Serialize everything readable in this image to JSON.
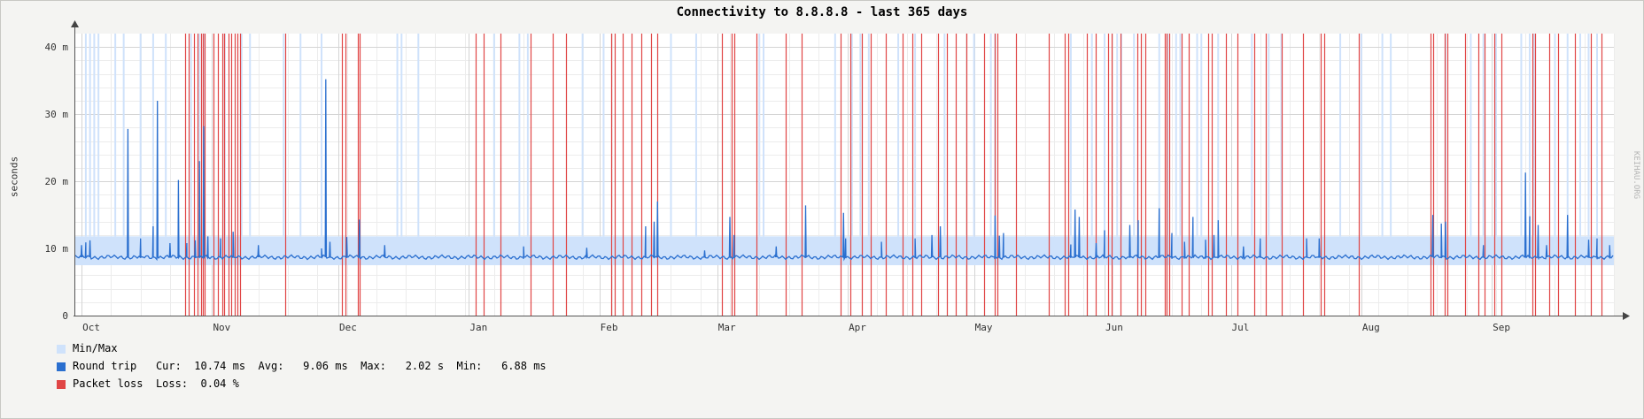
{
  "chart_data": {
    "type": "line",
    "title": "Connectivity to 8.8.8.8 - last 365 days",
    "ylabel": "seconds",
    "y_tick_labels": [
      "0",
      "10 m",
      "20 m",
      "30 m",
      "40 m"
    ],
    "y_ticks": [
      0,
      10,
      20,
      30,
      40
    ],
    "y_unit": "ms",
    "ylim": [
      0,
      42
    ],
    "x_tick_labels": [
      "Oct",
      "Nov",
      "Dec",
      "Jan",
      "Feb",
      "Mar",
      "Apr",
      "May",
      "Jun",
      "Jul",
      "Aug",
      "Sep"
    ],
    "x_tick_days": [
      0,
      31,
      61,
      92,
      123,
      151,
      182,
      212,
      243,
      273,
      304,
      335
    ],
    "xlim_days": [
      -1.5,
      364
    ],
    "grid": true,
    "legend_position": "bottom-left",
    "series": [
      {
        "name": "Min/Max",
        "kind": "band",
        "color": "#cfe2fb",
        "band_low_ms": 7.5,
        "band_high_ms": 11.8,
        "spike_days": [
          1,
          2,
          3,
          4,
          8,
          10,
          14,
          17,
          20,
          26,
          28,
          29,
          34,
          38,
          40,
          48,
          52,
          57,
          75,
          76,
          80,
          98,
          104,
          106,
          119,
          124,
          140,
          146,
          161,
          162,
          179,
          183,
          185,
          187,
          194,
          198,
          205,
          212,
          216,
          217,
          235,
          240,
          243,
          246,
          247,
          250,
          256,
          258,
          260,
          261,
          265,
          266,
          270,
          278,
          282,
          285,
          299,
          304,
          309,
          311,
          324,
          330,
          333,
          336,
          342,
          344,
          345,
          350,
          353,
          356,
          358,
          360
        ]
      },
      {
        "name": "Round trip",
        "kind": "line",
        "color": "#2a6fcf",
        "baseline_ms": 8.7,
        "spikes": [
          {
            "day": 0,
            "ms": 10.5
          },
          {
            "day": 1,
            "ms": 10.9
          },
          {
            "day": 2,
            "ms": 11.2
          },
          {
            "day": 11,
            "ms": 27.8
          },
          {
            "day": 14,
            "ms": 11.5
          },
          {
            "day": 17,
            "ms": 13.3
          },
          {
            "day": 18,
            "ms": 32.0
          },
          {
            "day": 21,
            "ms": 10.8
          },
          {
            "day": 23,
            "ms": 20.2
          },
          {
            "day": 25,
            "ms": 10.8
          },
          {
            "day": 27,
            "ms": 11.2
          },
          {
            "day": 28,
            "ms": 23.0
          },
          {
            "day": 29,
            "ms": 28.2
          },
          {
            "day": 30,
            "ms": 11.8
          },
          {
            "day": 33,
            "ms": 11.5
          },
          {
            "day": 36,
            "ms": 12.5
          },
          {
            "day": 42,
            "ms": 10.5
          },
          {
            "day": 57,
            "ms": 10.0
          },
          {
            "day": 58,
            "ms": 35.2
          },
          {
            "day": 59,
            "ms": 11.0
          },
          {
            "day": 63,
            "ms": 11.7
          },
          {
            "day": 66,
            "ms": 14.3
          },
          {
            "day": 72,
            "ms": 10.5
          },
          {
            "day": 105,
            "ms": 10.3
          },
          {
            "day": 120,
            "ms": 10.1
          },
          {
            "day": 134,
            "ms": 13.3
          },
          {
            "day": 136,
            "ms": 14.0
          },
          {
            "day": 136.8,
            "ms": 17.0
          },
          {
            "day": 148,
            "ms": 9.7
          },
          {
            "day": 154,
            "ms": 14.7
          },
          {
            "day": 155,
            "ms": 12.0
          },
          {
            "day": 165,
            "ms": 10.3
          },
          {
            "day": 172,
            "ms": 16.4
          },
          {
            "day": 181,
            "ms": 15.3
          },
          {
            "day": 181.5,
            "ms": 11.5
          },
          {
            "day": 190,
            "ms": 11.0
          },
          {
            "day": 198,
            "ms": 11.5
          },
          {
            "day": 202,
            "ms": 12.0
          },
          {
            "day": 204,
            "ms": 13.3
          },
          {
            "day": 217,
            "ms": 14.9
          },
          {
            "day": 218,
            "ms": 11.9
          },
          {
            "day": 219,
            "ms": 12.3
          },
          {
            "day": 235,
            "ms": 10.6
          },
          {
            "day": 236,
            "ms": 15.8
          },
          {
            "day": 237,
            "ms": 14.7
          },
          {
            "day": 241,
            "ms": 10.8
          },
          {
            "day": 243,
            "ms": 12.7
          },
          {
            "day": 249,
            "ms": 13.5
          },
          {
            "day": 251,
            "ms": 14.2
          },
          {
            "day": 256,
            "ms": 16.0
          },
          {
            "day": 259,
            "ms": 12.3
          },
          {
            "day": 262,
            "ms": 11.0
          },
          {
            "day": 264,
            "ms": 14.7
          },
          {
            "day": 267,
            "ms": 11.3
          },
          {
            "day": 269,
            "ms": 12.0
          },
          {
            "day": 270,
            "ms": 14.2
          },
          {
            "day": 276,
            "ms": 10.3
          },
          {
            "day": 280,
            "ms": 11.5
          },
          {
            "day": 291,
            "ms": 11.5
          },
          {
            "day": 294,
            "ms": 11.5
          },
          {
            "day": 321,
            "ms": 15.0
          },
          {
            "day": 323,
            "ms": 13.7
          },
          {
            "day": 324,
            "ms": 14.0
          },
          {
            "day": 333,
            "ms": 10.5
          },
          {
            "day": 343,
            "ms": 21.3
          },
          {
            "day": 344,
            "ms": 14.8
          },
          {
            "day": 346,
            "ms": 13.5
          },
          {
            "day": 348,
            "ms": 10.5
          },
          {
            "day": 353,
            "ms": 15.0
          },
          {
            "day": 358,
            "ms": 11.3
          },
          {
            "day": 360,
            "ms": 11.5
          },
          {
            "day": 363,
            "ms": 10.5
          }
        ]
      },
      {
        "name": "Packet loss",
        "kind": "vlines",
        "color": "#e04545",
        "days": [
          24.5,
          25.4,
          26.8,
          27.5,
          28.4,
          28.9,
          29.3,
          31.4,
          32.3,
          33.4,
          33.8,
          35.0,
          35.6,
          36.4,
          37.0,
          37.6,
          48.4,
          61.8,
          62.6,
          65.6,
          66.0,
          93.7,
          95.4,
          99.4,
          106.6,
          111.9,
          115.0,
          125.9,
          126.6,
          128.6,
          130.6,
          133.0,
          135.2,
          136.8,
          152.1,
          154.4,
          155.0,
          160.4,
          167.3,
          171.1,
          180.3,
          182.6,
          185.3,
          187.4,
          191.0,
          195.0,
          197.3,
          199.4,
          203.4,
          205.6,
          207.6,
          210.1,
          214.3,
          216.9,
          217.6,
          222.0,
          229.8,
          233.6,
          234.3,
          238.8,
          240.9,
          243.9,
          244.6,
          246.8,
          250.8,
          251.7,
          252.6,
          257.3,
          257.8,
          258.4,
          261.3,
          263.1,
          267.7,
          268.4,
          271.9,
          274.6,
          278.6,
          281.3,
          285.1,
          290.1,
          294.4,
          295.1,
          303.3,
          320.5,
          321.1,
          323.8,
          324.4,
          328.7,
          331.8,
          333.3,
          335.6,
          337.3,
          344.6,
          345.3,
          348.6,
          350.8,
          354.8,
          358.6,
          361.1
        ]
      }
    ],
    "legend": [
      {
        "label": "Min/Max",
        "color": "#cfe2fb"
      },
      {
        "label": "Round trip",
        "color": "#2a6fcf",
        "stats": "Cur:  10.74 ms  Avg:   9.06 ms  Max:   2.02 s  Min:   6.88 ms"
      },
      {
        "label": "Packet loss",
        "color": "#e04545",
        "stats": "Loss:  0.04 %"
      }
    ],
    "watermark": "KEIHAU.ORG"
  }
}
